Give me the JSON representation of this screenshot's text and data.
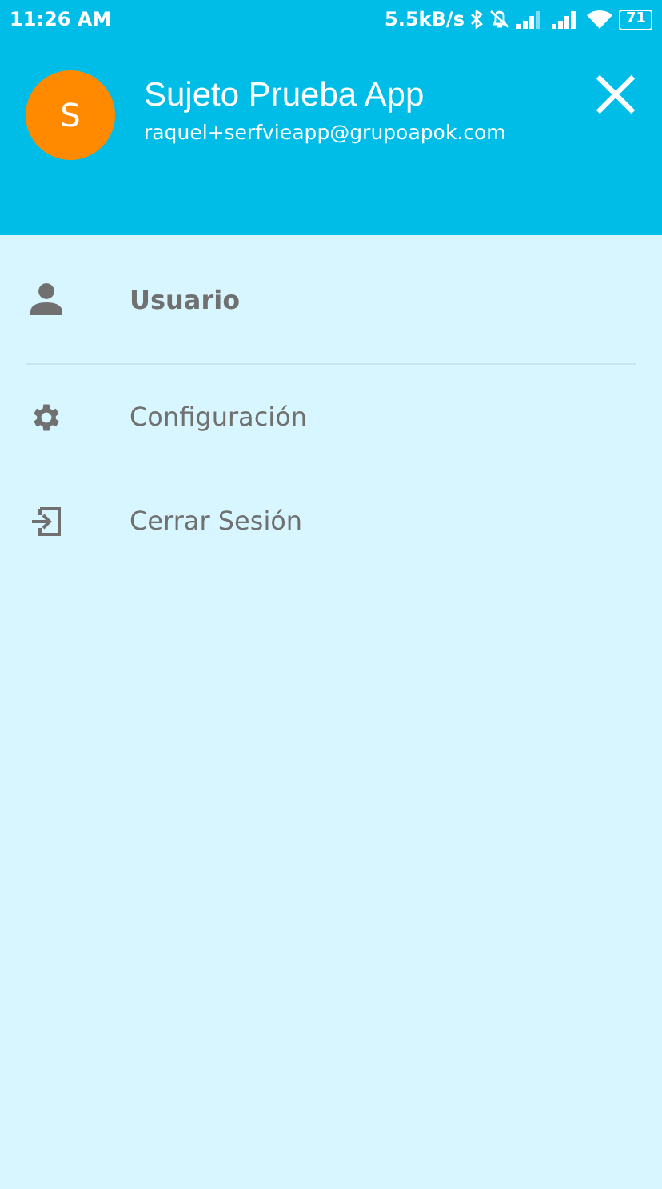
{
  "status_bar": {
    "time": "11:26 AM",
    "speed": "5.5kB/s",
    "battery": "71"
  },
  "header": {
    "avatar_letter": "S",
    "name": "Sujeto Prueba App",
    "email": "raquel+serfvieapp@grupoapok.com"
  },
  "menu": [
    {
      "kind": "user",
      "label": "Usuario",
      "selected": true,
      "divider": true
    },
    {
      "kind": "settings",
      "label": "Configuración",
      "selected": false,
      "divider": false
    },
    {
      "kind": "logout",
      "label": "Cerrar Sesión",
      "selected": false,
      "divider": false
    }
  ]
}
